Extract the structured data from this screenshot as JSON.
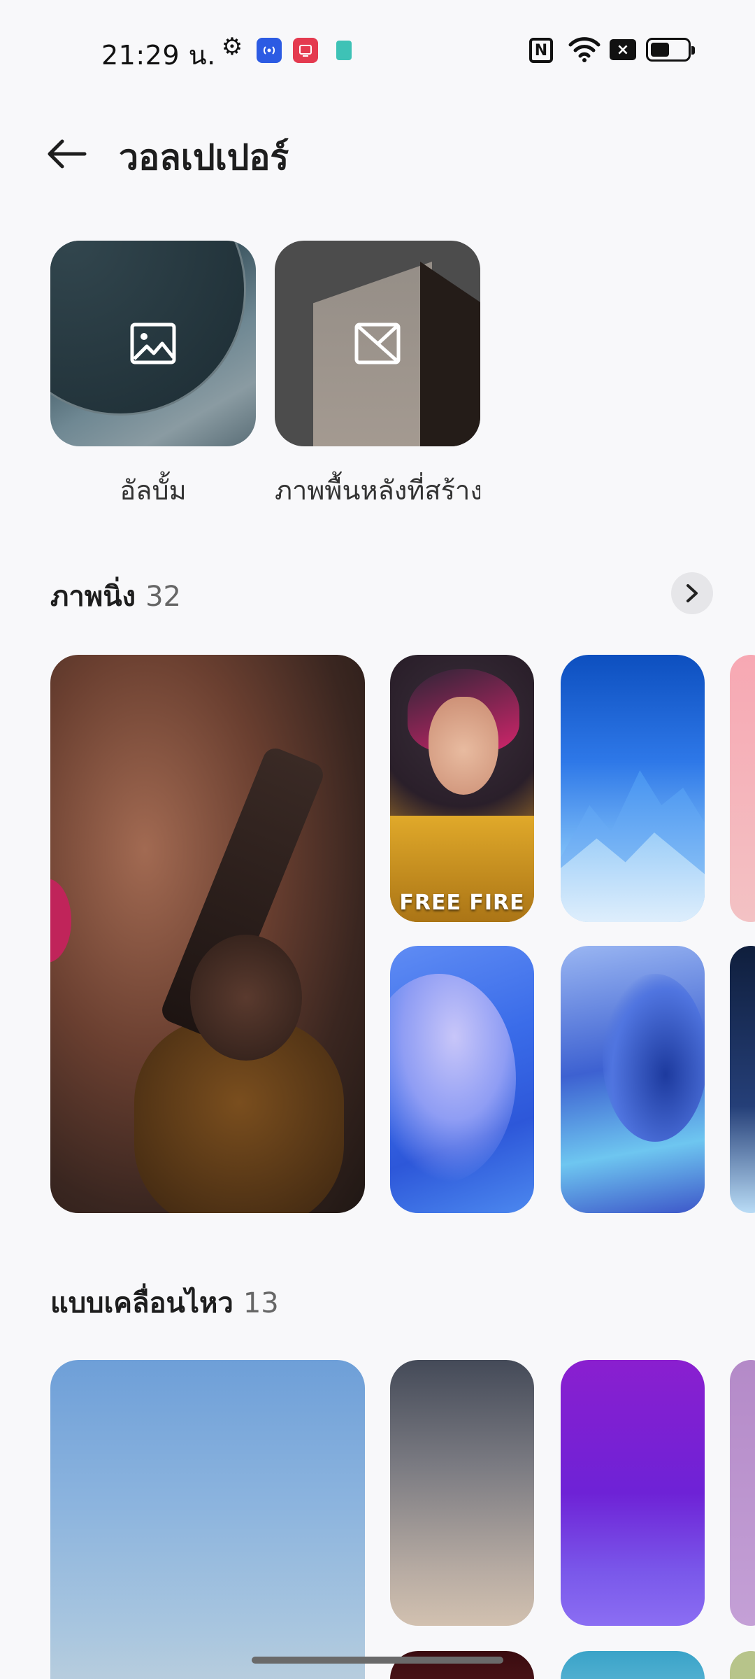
{
  "status_bar": {
    "time": "21:29 น.",
    "icons": [
      "gear-icon",
      "hotspot-icon",
      "screen-record-icon",
      "app-icon",
      "nfc-icon",
      "wifi-icon",
      "no-sim-icon",
      "battery-icon"
    ],
    "nfc_glyph": "N",
    "no_sim_glyph": "×"
  },
  "header": {
    "title": "วอลเปเปอร์"
  },
  "top_cards": [
    {
      "label": "อัลบั้ม",
      "icon": "image-icon"
    },
    {
      "label": "ภาพพื้นหลังที่สร้างเอง",
      "icon": "custom-image-icon"
    }
  ],
  "sections": {
    "static": {
      "title": "ภาพนิ่ง",
      "count": "32"
    },
    "live": {
      "title": "แบบเคลื่อนไหว",
      "count": "13"
    }
  },
  "thumbnails": {
    "ff_logo": "FREE FIRE"
  },
  "colors": {
    "background": "#f8f8fa",
    "hotspot": "#2c5be3",
    "screen_record": "#e43a4f",
    "teal_app": "#3ec2b6"
  }
}
